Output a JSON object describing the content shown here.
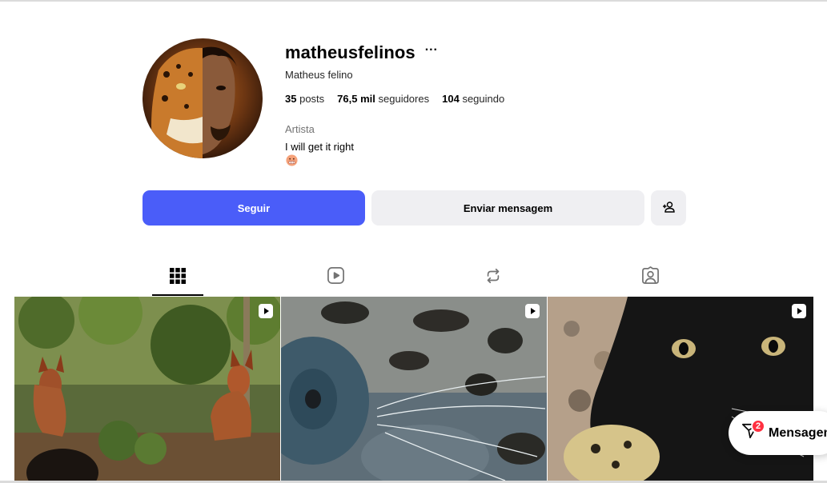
{
  "profile": {
    "username": "matheusfelinos",
    "more_label": "···",
    "full_name": "Matheus felino",
    "stats": {
      "posts_count": "35",
      "posts_label": "posts",
      "followers_count": "76,5 mil",
      "followers_label": "seguidores",
      "following_count": "104",
      "following_label": "seguindo"
    },
    "category": "Artista",
    "bio": "I will get it right"
  },
  "actions": {
    "follow_label": "Seguir",
    "message_label": "Enviar mensagem",
    "add_icon": "person-add-icon"
  },
  "tabs": [
    {
      "name": "posts",
      "icon": "grid-icon",
      "active": true
    },
    {
      "name": "reels",
      "icon": "reels-icon",
      "active": false
    },
    {
      "name": "reposts",
      "icon": "repost-icon",
      "active": false
    },
    {
      "name": "tagged",
      "icon": "tagged-icon",
      "active": false
    }
  ],
  "posts": [
    {
      "type": "reel",
      "subject": "maned wolves in forest"
    },
    {
      "type": "reel",
      "subject": "jaguar close-up"
    },
    {
      "type": "reel",
      "subject": "black panther"
    }
  ],
  "messages_pill": {
    "label": "Mensagens",
    "badge_count": "2"
  },
  "colors": {
    "follow_button": "#4a5df9",
    "secondary_button": "#efeff2",
    "badge": "#ff3040"
  }
}
